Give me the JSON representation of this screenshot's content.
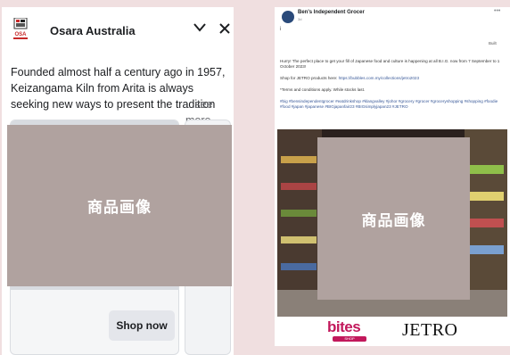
{
  "left_ad": {
    "brand_name": "Osara Australia",
    "logo_text": "OSA",
    "description": "Founded almost half a century ago in 1957, Keizangama Kiln from Arita is always seeking new ways to present the tradition",
    "see_more": "...see more",
    "cta_label": "Shop now"
  },
  "right_post": {
    "author": "Ben's Independent Grocer",
    "meta": "3d",
    "translate": "Built",
    "body_main": "Hurry! The perfect place to get your fill of Japanese food and culture is happening at all B.I.G. now from 7 September to 1 October 2023!",
    "shop_text": "Shop for JETRO products here: ",
    "shop_link": "https://bubbles.com.my/collections/jetro2023",
    "terms": "*Terms and conditions apply. While stocks last.",
    "hashtags": "#big #bensindependentgrocer #eatdrinkshop #klangvalley #johor #grocery #grocer #groceryshopping #shopping #foodie #food #japan #japanese #BIGjapanfair23 #BIGsimplyjapan23 #JETRO",
    "logo_bites": "bites",
    "logo_bites_sub": "SHOP",
    "logo_jetro": "JETRO"
  },
  "placeholders": {
    "left_label": "商品画像",
    "right_label": "商品画像"
  },
  "colors": {
    "page_bg": "#f0dfe0",
    "placeholder": "#b0a29f",
    "bites_pink": "#c2185b",
    "link_blue": "#385898"
  }
}
